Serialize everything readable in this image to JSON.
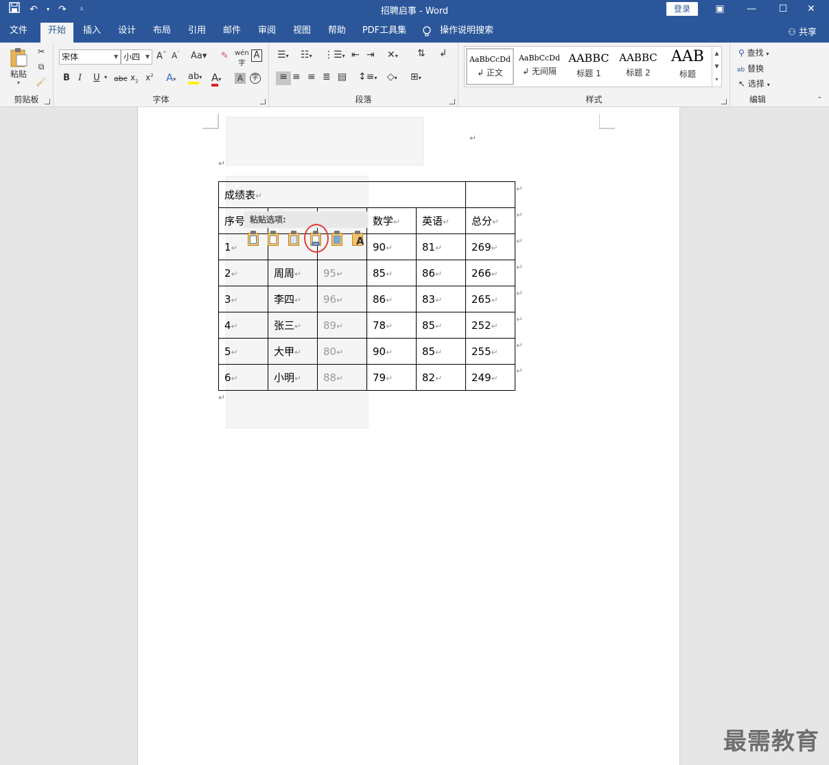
{
  "title_bar": {
    "document_title": "招聘启事  -  Word",
    "login_label": "登录",
    "qat": [
      "save-icon",
      "undo-icon",
      "redo-icon",
      "customize-icon"
    ]
  },
  "tabs": {
    "items": [
      "文件",
      "开始",
      "插入",
      "设计",
      "布局",
      "引用",
      "邮件",
      "审阅",
      "视图",
      "帮助",
      "PDF工具集"
    ],
    "tell_me": "操作说明搜索",
    "share": "共享"
  },
  "ribbon": {
    "clipboard": {
      "paste_label": "粘贴",
      "group_label": "剪贴板"
    },
    "font": {
      "font_name": "宋体",
      "font_size": "小四",
      "group_label": "字体"
    },
    "paragraph": {
      "group_label": "段落"
    },
    "styles": {
      "group_label": "样式",
      "items": [
        {
          "sample": "AaBbCcDd",
          "name": "↲ 正文"
        },
        {
          "sample": "AaBbCcDd",
          "name": "↲ 无间隔"
        },
        {
          "sample": "AABBC",
          "name": "标题 1"
        },
        {
          "sample": "AABBC",
          "name": "标题 2"
        },
        {
          "sample": "AAB",
          "name": "标题"
        }
      ]
    },
    "editing": {
      "find": "查找",
      "replace": "替换",
      "select": "选择",
      "group_label": "编辑"
    }
  },
  "document": {
    "table_title": "成绩表",
    "headers": [
      "序号",
      "",
      "",
      "数学",
      "英语",
      "总分"
    ],
    "rows": [
      [
        "1",
        "",
        "",
        "90",
        "81",
        "269"
      ],
      [
        "2",
        "周周",
        "95",
        "85",
        "86",
        "266"
      ],
      [
        "3",
        "李四",
        "96",
        "86",
        "83",
        "265"
      ],
      [
        "4",
        "张三",
        "89",
        "78",
        "85",
        "252"
      ],
      [
        "5",
        "大甲",
        "80",
        "90",
        "85",
        "255"
      ],
      [
        "6",
        "小明",
        "88",
        "79",
        "82",
        "249"
      ]
    ]
  },
  "paste_options": {
    "header": "粘贴选项:",
    "icons": [
      "paste-nested-table-icon",
      "paste-merge-table-icon",
      "paste-insert-rows-icon",
      "paste-link-icon",
      "paste-picture-icon",
      "paste-text-only-icon"
    ]
  },
  "watermark": "最需教育"
}
